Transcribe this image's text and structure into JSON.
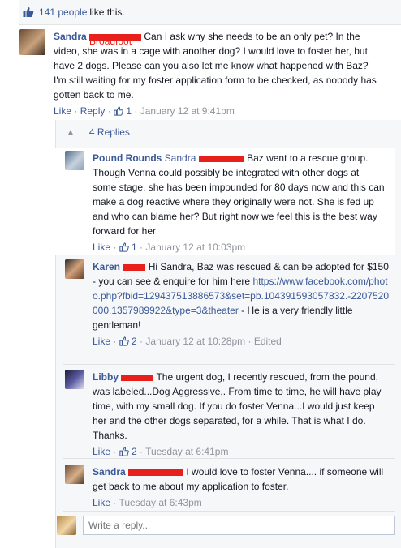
{
  "likes": {
    "count": "141 people",
    "suffix": "like this."
  },
  "comment": {
    "author": "Sandra",
    "redacted": "Broadfoot",
    "text": "Can I ask why she needs to be an only pet? In the video, she was in a cage with another dog? I would love to foster her, but have 2 dogs. Please can you also let me know what happened with Baz? I'm still waiting for my foster application form to be checked, as nobody has gotten back to me.",
    "like": "Like",
    "reply": "Reply",
    "likes": "1",
    "time": "January 12 at 9:41pm"
  },
  "replies_toggle": "4 Replies",
  "replies": [
    {
      "author": "Pound Rounds",
      "mention": "Sandra",
      "text": "Baz went to a rescue group. Though Venna could possibly be integrated with other dogs at some stage, she has been impounded for 80 days now and this can make a dog reactive where they originally were not. She is fed up and who can blame her? But right now we feel this is the best way forward for her",
      "like": "Like",
      "likes": "1",
      "time": "January 12 at 10:03pm"
    },
    {
      "author": "Karen",
      "text_before": "Hi Sandra, Baz was rescued & can be adopted for $150 - you can see & enquire for him here",
      "url": "https://www.facebook.com/photo.php?fbid=129437513886573&set=pb.104391593057832.-2207520000.1357989922&type=3&theater",
      "text_after": "- He is a very friendly little gentleman!",
      "like": "Like",
      "likes": "2",
      "time": "January 12 at 10:28pm",
      "edited": "Edited"
    },
    {
      "author": "Libby",
      "text": "The urgent dog, I recently rescued, from the pound, was labeled...Dog Aggressive,. From time to time, he will have play time, with my small dog. If you do foster Venna...I would just keep her and the other dogs separated, for a while. That is what I do. Thanks.",
      "like": "Like",
      "likes": "2",
      "time": "Tuesday at 6:41pm"
    },
    {
      "author": "Sandra",
      "text": "I would love to foster Venna.... if someone will get back to me about my application to foster.",
      "like": "Like",
      "time": "Tuesday at 6:43pm"
    }
  ],
  "reply_input": {
    "placeholder": "Write a reply..."
  },
  "colors": {
    "link": "#3b5998",
    "redaction": "#e8201c",
    "meta": "#90949c"
  }
}
